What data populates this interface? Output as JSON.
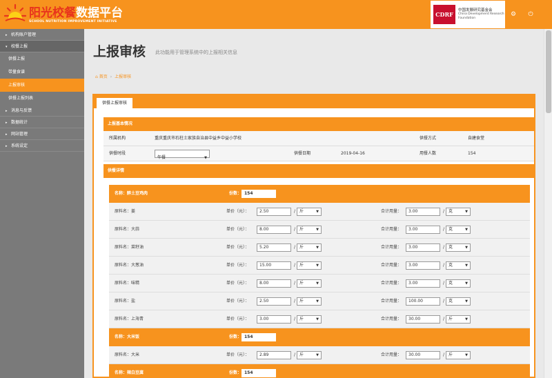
{
  "header": {
    "logo_main_red": "阳光校餐",
    "logo_main": "数据平台",
    "logo_sub": "SCHOOL NUTRITION IMPROVEMENT INITIATIVE",
    "partner_abbr": "CDRF",
    "partner_cn": "中国发展研究基金会",
    "partner_en1": "China Development Research",
    "partner_en2": "Foundation",
    "icon_1": "gear-icon",
    "icon_2": "power-icon",
    "brand_color": "#f7931e"
  },
  "sidebar": {
    "items": [
      {
        "label": "机构账户管理"
      },
      {
        "label": "校餐上报"
      },
      {
        "label": "供餐上报"
      },
      {
        "label": "带量食谱"
      },
      {
        "label": "上报审核"
      },
      {
        "label": "供餐上报列表"
      },
      {
        "label": "消息与反馈"
      },
      {
        "label": "数据统计"
      },
      {
        "label": "网站管理"
      },
      {
        "label": "系统设定"
      }
    ]
  },
  "page": {
    "title": "上报审核",
    "description": "此功能用于管理系统中的上报相关信息",
    "breadcrumb_home": "首页",
    "breadcrumb_current": "上报审核",
    "tab": "供餐上报审核"
  },
  "basic": {
    "header": "上报基本情况",
    "org_label": "所属机构",
    "org_value": "重庆重庆市石柱土家族自治县中益乡中益小学校",
    "method_label": "供餐方式",
    "method_value": "自建食堂",
    "time_label": "供餐时段",
    "time_value": "午餐",
    "date_label": "供餐日期",
    "date_value": "2019-04-16",
    "count_label": "用餐人数",
    "count_value": "154"
  },
  "details": {
    "header": "供餐详情",
    "name_prefix": "名称：",
    "qty_label": "份数：",
    "ing_prefix": "原料名：",
    "price_label": "单价（元）：",
    "usage_label": "合计用量：",
    "slash": "/",
    "dishes": [
      {
        "name": "醉土豆鸡肉",
        "qty": "154",
        "ingredients": [
          {
            "name": "姜",
            "price": "2.50",
            "unit": "斤",
            "usage": "3.00",
            "usage_unit": "克"
          },
          {
            "name": "大蒜",
            "price": "8.00",
            "unit": "斤",
            "usage": "3.00",
            "usage_unit": "克"
          },
          {
            "name": "菜籽油",
            "price": "5.20",
            "unit": "斤",
            "usage": "3.00",
            "usage_unit": "克"
          },
          {
            "name": "大葱油",
            "price": "15.00",
            "unit": "斤",
            "usage": "3.00",
            "usage_unit": "克"
          },
          {
            "name": "味精",
            "price": "8.00",
            "unit": "斤",
            "usage": "3.00",
            "usage_unit": "克"
          },
          {
            "name": "盐",
            "price": "2.50",
            "unit": "斤",
            "usage": "100.00",
            "usage_unit": "克"
          },
          {
            "name": "上海青",
            "price": "3.00",
            "unit": "斤",
            "usage": "30.00",
            "usage_unit": "斤"
          }
        ]
      },
      {
        "name": "大米饭",
        "qty": "154",
        "ingredients": [
          {
            "name": "大米",
            "price": "2.89",
            "unit": "斤",
            "usage": "30.00",
            "usage_unit": "斤"
          }
        ]
      },
      {
        "name": "辣白豆腐",
        "qty": "154",
        "ingredients": []
      }
    ]
  }
}
